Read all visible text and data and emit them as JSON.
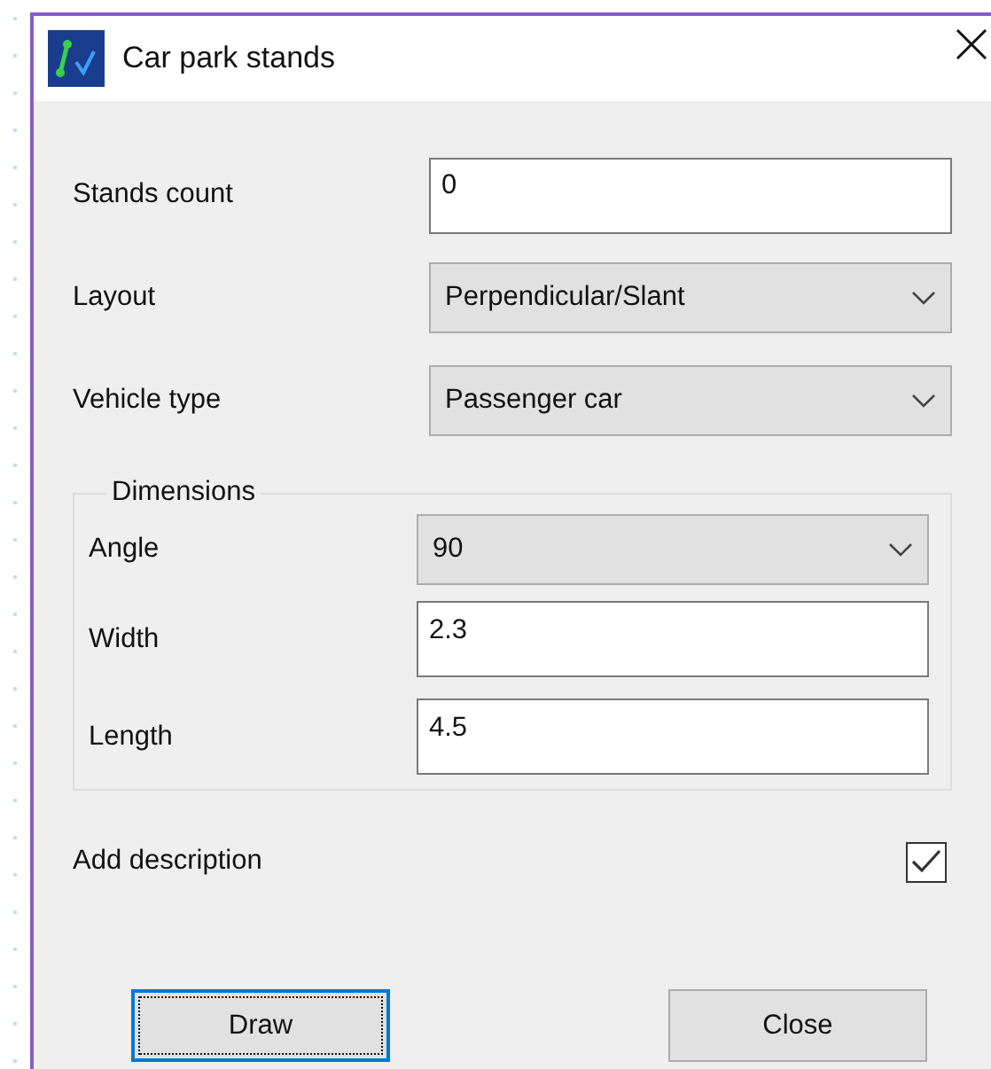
{
  "window": {
    "title": "Car park stands"
  },
  "fields": [
    {
      "label": "Stands count",
      "kind": "text",
      "value": "0"
    },
    {
      "label": "Layout",
      "kind": "combo",
      "value": "Perpendicular/Slant"
    },
    {
      "label": "Vehicle type",
      "kind": "combo",
      "value": "Passenger car"
    }
  ],
  "dimensions": {
    "legend": "Dimensions",
    "fields": [
      {
        "label": "Angle",
        "kind": "combo",
        "value": "90"
      },
      {
        "label": "Width",
        "kind": "text",
        "value": "2.3"
      },
      {
        "label": "Length",
        "kind": "text",
        "value": "4.5"
      }
    ]
  },
  "add_description": {
    "label": "Add description",
    "checked": true
  },
  "buttons": [
    {
      "label": "Draw",
      "focused": true
    },
    {
      "label": "Close",
      "focused": false
    }
  ]
}
